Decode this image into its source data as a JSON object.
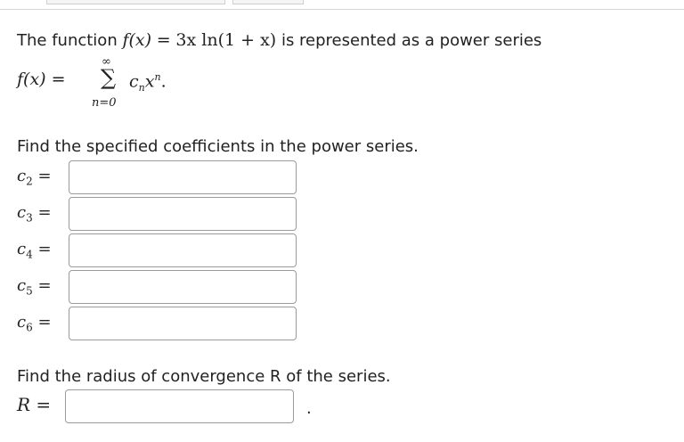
{
  "question": {
    "intro_prefix": "The function ",
    "function_lhs": "f(x)",
    "equals": "=",
    "function_rhs": "3x ln(1 + x)",
    "intro_suffix": " is represented as a power series",
    "series_lhs": "f(x) =",
    "sum_upper": "∞",
    "sum_symbol": "∑",
    "sum_lower": "n=0",
    "term_base": "c",
    "term_sub": "n",
    "term_var": "x",
    "term_sup": "n",
    "term_end": ".",
    "coeff_heading": "Find the specified coefficients in the power series.",
    "radius_heading": "Find the radius of convergence R of the series.",
    "radius_label": "R =",
    "period": "."
  },
  "coefficients": [
    {
      "base": "c",
      "index": "2",
      "eq": "=",
      "value": ""
    },
    {
      "base": "c",
      "index": "3",
      "eq": "=",
      "value": ""
    },
    {
      "base": "c",
      "index": "4",
      "eq": "=",
      "value": ""
    },
    {
      "base": "c",
      "index": "5",
      "eq": "=",
      "value": ""
    },
    {
      "base": "c",
      "index": "6",
      "eq": "=",
      "value": ""
    }
  ],
  "radius_value": ""
}
